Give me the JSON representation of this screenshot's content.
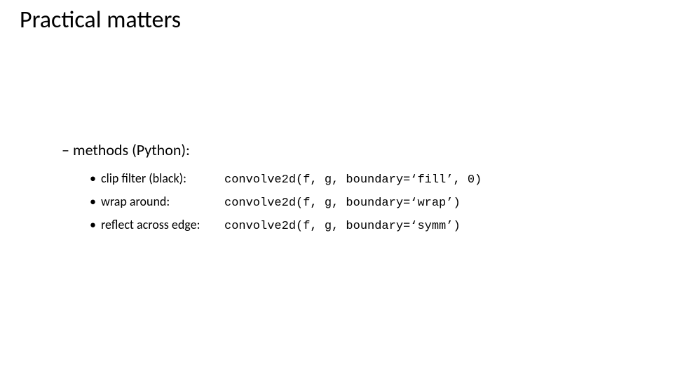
{
  "title": "Practical matters",
  "subheading_dash": "– ",
  "subheading": "methods (Python):",
  "bullet": "• ",
  "items": [
    {
      "label": "clip filter (black):",
      "code": "convolve2d(f, g, boundary=‘fill’, 0)"
    },
    {
      "label": "wrap around:",
      "code": "convolve2d(f, g, boundary=‘wrap’)"
    },
    {
      "label": "reflect across edge:",
      "code": "convolve2d(f, g, boundary=‘symm’)"
    }
  ]
}
